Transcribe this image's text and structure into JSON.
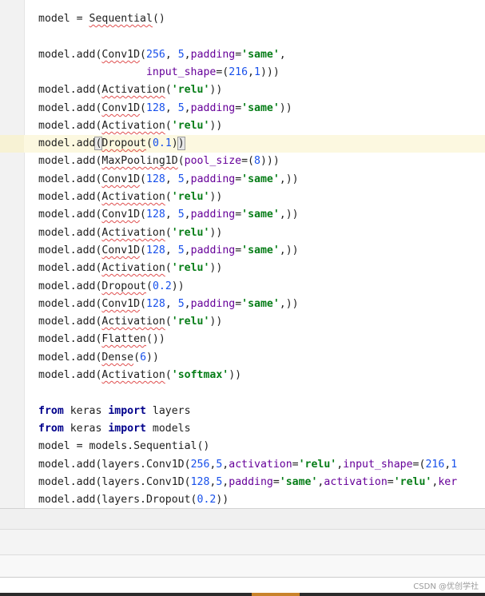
{
  "editor": {
    "lines": [
      {
        "tokens": [
          {
            "t": "model = "
          },
          {
            "t": "Sequential",
            "c": "err"
          },
          {
            "t": "()"
          }
        ]
      },
      {
        "tokens": []
      },
      {
        "tokens": [
          {
            "t": "model.add("
          },
          {
            "t": "Conv1D",
            "c": "err"
          },
          {
            "t": "("
          },
          {
            "t": "256",
            "c": "num"
          },
          {
            "t": ", "
          },
          {
            "t": "5",
            "c": "num"
          },
          {
            "t": ","
          },
          {
            "t": "padding",
            "c": "param"
          },
          {
            "t": "="
          },
          {
            "t": "'same'",
            "c": "str"
          },
          {
            "t": ","
          }
        ]
      },
      {
        "tokens": [
          {
            "t": "                 "
          },
          {
            "t": "input_shape",
            "c": "param"
          },
          {
            "t": "=("
          },
          {
            "t": "216",
            "c": "num"
          },
          {
            "t": ","
          },
          {
            "t": "1",
            "c": "num"
          },
          {
            "t": ")))"
          }
        ]
      },
      {
        "tokens": [
          {
            "t": "model.add("
          },
          {
            "t": "Activation",
            "c": "err"
          },
          {
            "t": "("
          },
          {
            "t": "'relu'",
            "c": "str"
          },
          {
            "t": "))"
          }
        ]
      },
      {
        "tokens": [
          {
            "t": "model.add("
          },
          {
            "t": "Conv1D",
            "c": "err"
          },
          {
            "t": "("
          },
          {
            "t": "128",
            "c": "num"
          },
          {
            "t": ", "
          },
          {
            "t": "5",
            "c": "num"
          },
          {
            "t": ","
          },
          {
            "t": "padding",
            "c": "param"
          },
          {
            "t": "="
          },
          {
            "t": "'same'",
            "c": "str"
          },
          {
            "t": "))"
          }
        ]
      },
      {
        "tokens": [
          {
            "t": "model.add("
          },
          {
            "t": "Activation",
            "c": "err"
          },
          {
            "t": "("
          },
          {
            "t": "'relu'",
            "c": "str"
          },
          {
            "t": "))"
          }
        ]
      },
      {
        "highlight": true,
        "tokens": [
          {
            "t": "model.add"
          },
          {
            "t": "(",
            "c": "brace"
          },
          {
            "t": "Dropout",
            "c": "err"
          },
          {
            "t": "("
          },
          {
            "t": "0.1",
            "c": "num"
          },
          {
            "t": ")"
          },
          {
            "t": ")",
            "c": "brace"
          },
          {
            "t": "",
            "c": "caret"
          }
        ]
      },
      {
        "tokens": [
          {
            "t": "model.add("
          },
          {
            "t": "MaxPooling1D",
            "c": "err"
          },
          {
            "t": "("
          },
          {
            "t": "pool_size",
            "c": "param"
          },
          {
            "t": "=("
          },
          {
            "t": "8",
            "c": "num"
          },
          {
            "t": ")))"
          }
        ]
      },
      {
        "tokens": [
          {
            "t": "model.add("
          },
          {
            "t": "Conv1D",
            "c": "err"
          },
          {
            "t": "("
          },
          {
            "t": "128",
            "c": "num"
          },
          {
            "t": ", "
          },
          {
            "t": "5",
            "c": "num"
          },
          {
            "t": ","
          },
          {
            "t": "padding",
            "c": "param"
          },
          {
            "t": "="
          },
          {
            "t": "'same'",
            "c": "str"
          },
          {
            "t": ",))"
          }
        ]
      },
      {
        "tokens": [
          {
            "t": "model.add("
          },
          {
            "t": "Activation",
            "c": "err"
          },
          {
            "t": "("
          },
          {
            "t": "'relu'",
            "c": "str"
          },
          {
            "t": "))"
          }
        ]
      },
      {
        "tokens": [
          {
            "t": "model.add("
          },
          {
            "t": "Conv1D",
            "c": "err"
          },
          {
            "t": "("
          },
          {
            "t": "128",
            "c": "num"
          },
          {
            "t": ", "
          },
          {
            "t": "5",
            "c": "num"
          },
          {
            "t": ","
          },
          {
            "t": "padding",
            "c": "param"
          },
          {
            "t": "="
          },
          {
            "t": "'same'",
            "c": "str"
          },
          {
            "t": ",))"
          }
        ]
      },
      {
        "tokens": [
          {
            "t": "model.add("
          },
          {
            "t": "Activation",
            "c": "err"
          },
          {
            "t": "("
          },
          {
            "t": "'relu'",
            "c": "str"
          },
          {
            "t": "))"
          }
        ]
      },
      {
        "tokens": [
          {
            "t": "model.add("
          },
          {
            "t": "Conv1D",
            "c": "err"
          },
          {
            "t": "("
          },
          {
            "t": "128",
            "c": "num"
          },
          {
            "t": ", "
          },
          {
            "t": "5",
            "c": "num"
          },
          {
            "t": ","
          },
          {
            "t": "padding",
            "c": "param"
          },
          {
            "t": "="
          },
          {
            "t": "'same'",
            "c": "str"
          },
          {
            "t": ",))"
          }
        ]
      },
      {
        "tokens": [
          {
            "t": "model.add("
          },
          {
            "t": "Activation",
            "c": "err"
          },
          {
            "t": "("
          },
          {
            "t": "'relu'",
            "c": "str"
          },
          {
            "t": "))"
          }
        ]
      },
      {
        "tokens": [
          {
            "t": "model.add("
          },
          {
            "t": "Dropout",
            "c": "err"
          },
          {
            "t": "("
          },
          {
            "t": "0.2",
            "c": "num"
          },
          {
            "t": "))"
          }
        ]
      },
      {
        "tokens": [
          {
            "t": "model.add("
          },
          {
            "t": "Conv1D",
            "c": "err"
          },
          {
            "t": "("
          },
          {
            "t": "128",
            "c": "num"
          },
          {
            "t": ", "
          },
          {
            "t": "5",
            "c": "num"
          },
          {
            "t": ","
          },
          {
            "t": "padding",
            "c": "param"
          },
          {
            "t": "="
          },
          {
            "t": "'same'",
            "c": "str"
          },
          {
            "t": ",))"
          }
        ]
      },
      {
        "tokens": [
          {
            "t": "model.add("
          },
          {
            "t": "Activation",
            "c": "err"
          },
          {
            "t": "("
          },
          {
            "t": "'relu'",
            "c": "str"
          },
          {
            "t": "))"
          }
        ]
      },
      {
        "tokens": [
          {
            "t": "model.add("
          },
          {
            "t": "Flatten",
            "c": "err"
          },
          {
            "t": "())"
          }
        ]
      },
      {
        "tokens": [
          {
            "t": "model.add("
          },
          {
            "t": "Dense",
            "c": "err"
          },
          {
            "t": "("
          },
          {
            "t": "6",
            "c": "num"
          },
          {
            "t": "))"
          }
        ]
      },
      {
        "tokens": [
          {
            "t": "model.add("
          },
          {
            "t": "Activation",
            "c": "err"
          },
          {
            "t": "("
          },
          {
            "t": "'softmax'",
            "c": "str"
          },
          {
            "t": "))"
          }
        ]
      },
      {
        "tokens": []
      },
      {
        "tokens": [
          {
            "t": "from",
            "c": "kw"
          },
          {
            "t": " keras "
          },
          {
            "t": "import",
            "c": "kw"
          },
          {
            "t": " layers"
          }
        ]
      },
      {
        "tokens": [
          {
            "t": "from",
            "c": "kw"
          },
          {
            "t": " keras "
          },
          {
            "t": "import",
            "c": "kw"
          },
          {
            "t": " models"
          }
        ]
      },
      {
        "tokens": [
          {
            "t": "model = models.Sequential()"
          }
        ]
      },
      {
        "tokens": [
          {
            "t": "model.add(layers.Conv1D("
          },
          {
            "t": "256",
            "c": "num"
          },
          {
            "t": ","
          },
          {
            "t": "5",
            "c": "num"
          },
          {
            "t": ","
          },
          {
            "t": "activation",
            "c": "param"
          },
          {
            "t": "="
          },
          {
            "t": "'relu'",
            "c": "str"
          },
          {
            "t": ","
          },
          {
            "t": "input_shape",
            "c": "param"
          },
          {
            "t": "=("
          },
          {
            "t": "216",
            "c": "num"
          },
          {
            "t": ","
          },
          {
            "t": "1",
            "c": "num"
          }
        ]
      },
      {
        "tokens": [
          {
            "t": "model.add(layers.Conv1D("
          },
          {
            "t": "128",
            "c": "num"
          },
          {
            "t": ","
          },
          {
            "t": "5",
            "c": "num"
          },
          {
            "t": ","
          },
          {
            "t": "padding",
            "c": "param"
          },
          {
            "t": "="
          },
          {
            "t": "'same'",
            "c": "str"
          },
          {
            "t": ","
          },
          {
            "t": "activation",
            "c": "param"
          },
          {
            "t": "="
          },
          {
            "t": "'relu'",
            "c": "str"
          },
          {
            "t": ","
          },
          {
            "t": "ker",
            "c": "param"
          }
        ]
      },
      {
        "tokens": [
          {
            "t": "model.add(layers.Dropout("
          },
          {
            "t": "0.2",
            "c": "num"
          },
          {
            "t": "))"
          }
        ]
      }
    ]
  },
  "watermark": "CSDN @优创学社"
}
